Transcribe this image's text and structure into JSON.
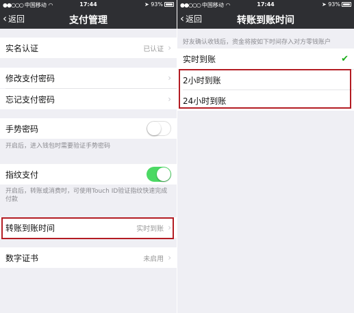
{
  "left": {
    "status": {
      "carrier": "中国移动",
      "time": "17:44",
      "battery": "93%"
    },
    "nav": {
      "back": "返回",
      "title": "支付管理"
    },
    "rows": {
      "real_name": {
        "label": "实名认证",
        "value": "已认证"
      },
      "change_pwd": {
        "label": "修改支付密码"
      },
      "forgot_pwd": {
        "label": "忘记支付密码"
      },
      "gesture": {
        "label": "手势密码",
        "hint": "开启后，进入钱包时需要验证手势密码",
        "enabled": false
      },
      "fingerprint": {
        "label": "指纹支付",
        "hint": "开启后，转账或消费时，可使用Touch ID验证指纹快速完成付款",
        "enabled": true
      },
      "transfer_time": {
        "label": "转账到账时间",
        "value": "实时到账"
      },
      "certificate": {
        "label": "数字证书",
        "value": "未启用"
      }
    }
  },
  "right": {
    "status": {
      "carrier": "中国移动",
      "time": "17:44",
      "battery": "93%"
    },
    "nav": {
      "back": "返回",
      "title": "转账到账时间"
    },
    "note": "好友确认收钱后，资金将按如下时间存入对方零钱账户",
    "options": [
      {
        "label": "实时到账",
        "selected": true
      },
      {
        "label": "2小时到账",
        "selected": false
      },
      {
        "label": "24小时到账",
        "selected": false
      }
    ]
  },
  "colors": {
    "nav_bg": "#2e2f33",
    "toggle_on": "#4cd964",
    "check": "#1aad19",
    "highlight_box": "#b31b22"
  },
  "icons": {
    "back": "chevron-left-icon",
    "arrow": "chevron-right-icon",
    "check": "checkmark-icon",
    "wifi": "wifi-icon",
    "location": "location-arrow-icon",
    "battery": "battery-icon"
  }
}
